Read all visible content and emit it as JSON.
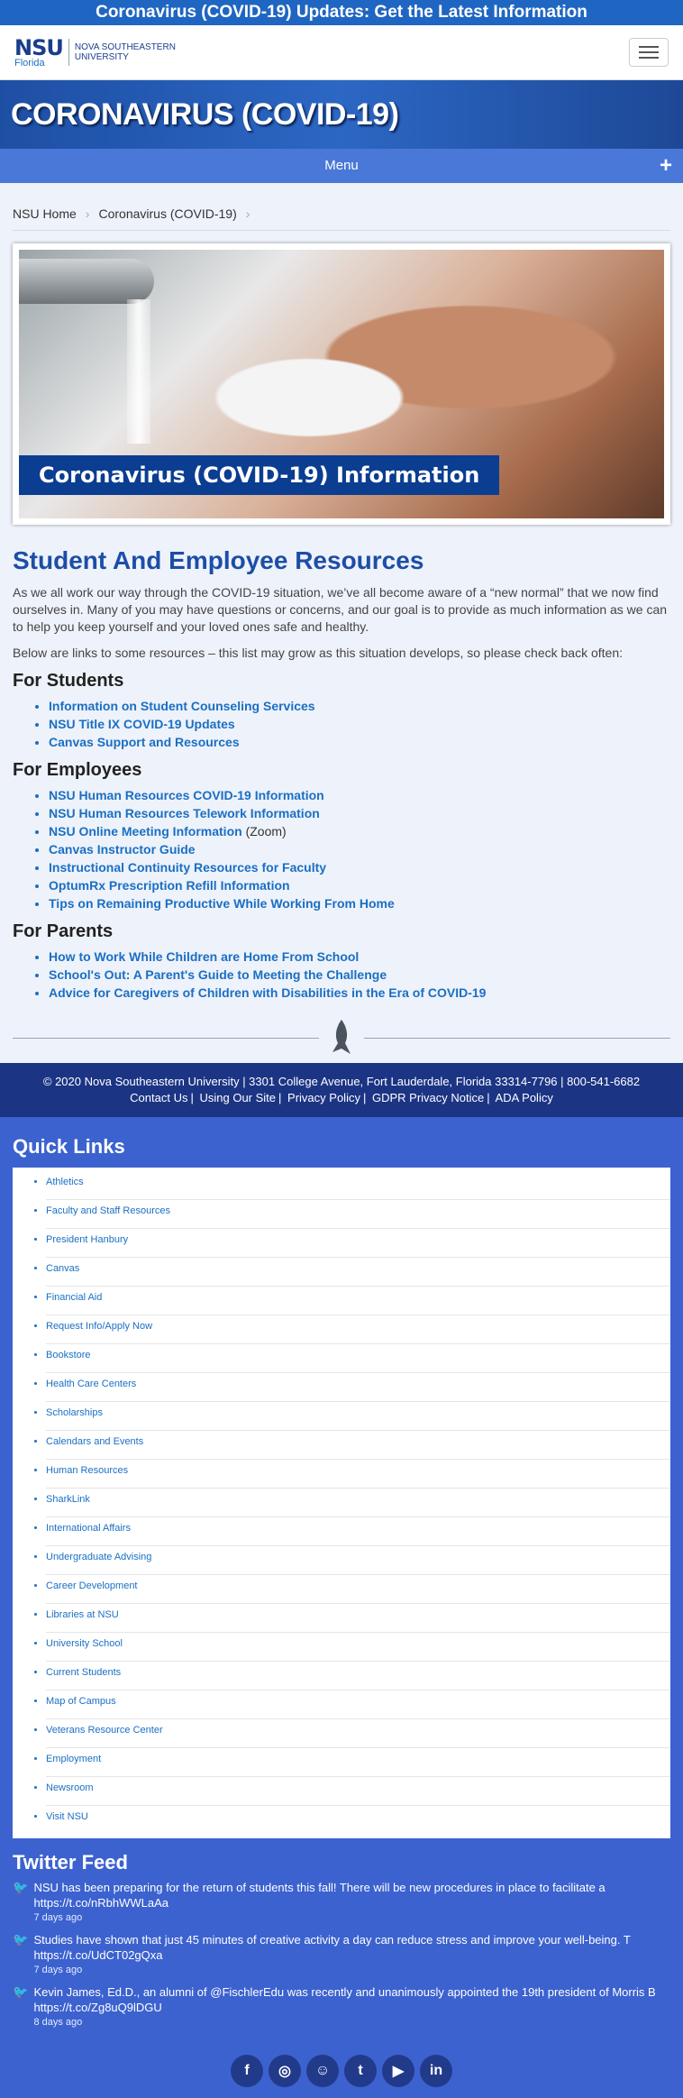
{
  "alert": {
    "text": "Coronavirus (COVID-19) Updates: Get the Latest Information"
  },
  "header": {
    "logo_abbr": "NSU",
    "logo_state": "Florida",
    "logo_name_line1": "NOVA SOUTHEASTERN",
    "logo_name_line2": "UNIVERSITY",
    "menu_icon": "hamburger-icon"
  },
  "hero": {
    "title": "CORONAVIRUS (COVID-19)"
  },
  "menu": {
    "label": "Menu",
    "expand": "+"
  },
  "breadcrumb": {
    "items": [
      "NSU Home",
      "Coronavirus (COVID-19)"
    ]
  },
  "banner": {
    "caption": "Coronavirus (COVID-19) Information"
  },
  "main": {
    "title": "Student And Employee Resources",
    "intro": "As we all work our way through the COVID-19 situation, we’ve all become aware of a “new normal” that we now find ourselves in. Many of you may have questions or concerns, and our goal is to provide as much information as we can to help you keep yourself and your loved ones safe and healthy.",
    "intro2": "Below are links to some resources – this list may grow as this situation develops, so please check back often:",
    "students": {
      "heading": "For Students",
      "links": [
        "Information on Student Counseling Services",
        "NSU Title IX COVID-19 Updates",
        "Canvas Support and Resources"
      ]
    },
    "employees": {
      "heading": "For Employees",
      "links": [
        "NSU Human Resources COVID-19 Information",
        "NSU Human Resources Telework Information",
        "NSU Online Meeting Information",
        "Canvas Instructor Guide",
        "Instructional Continuity Resources for Faculty",
        "OptumRx Prescription Refill Information",
        "Tips on Remaining Productive While Working From Home"
      ],
      "zoom_note": "(Zoom)"
    },
    "parents": {
      "heading": "For Parents",
      "links": [
        "How to Work While Children are Home From School",
        "School's Out: A Parent's Guide to Meeting the Challenge",
        "Advice for Caregivers of Children with Disabilities in the Era of COVID-19"
      ]
    }
  },
  "footer": {
    "address": "© 2020 Nova Southeastern University | 3301 College Avenue, Fort Lauderdale, Florida 33314-7796 | 800-541-6682",
    "links": [
      "Contact Us",
      "Using Our Site",
      "Privacy Policy",
      "GDPR Privacy Notice",
      "ADA Policy"
    ]
  },
  "quick_links": {
    "title": "Quick Links",
    "items": [
      "Athletics",
      "Faculty and Staff Resources",
      "President Hanbury",
      "Canvas",
      "Financial Aid",
      "Request Info/Apply Now",
      "Bookstore",
      "Health Care Centers",
      "Scholarships",
      "Calendars and Events",
      "Human Resources",
      "SharkLink",
      "International Affairs",
      "Undergraduate Advising",
      "Career Development",
      "Libraries at NSU",
      "University School",
      "Current Students",
      "Map of Campus",
      "Veterans Resource Center",
      "Employment",
      "Newsroom",
      "Visit NSU"
    ]
  },
  "twitter": {
    "title": "Twitter Feed",
    "tweets": [
      {
        "text": "NSU has been preparing for the return of students this fall! There will be new procedures in place to facilitate a https://t.co/nRbhWWLaAa",
        "time": "7 days ago"
      },
      {
        "text": "Studies have shown that just 45 minutes of creative activity a day can reduce stress and improve your well-being. T https://t.co/UdCT02gQxa",
        "time": "7 days ago"
      },
      {
        "text": "Kevin James, Ed.D., an alumni of @FischlerEdu was recently and unanimously appointed the 19th president of Morris B https://t.co/Zg8uQ9lDGU",
        "time": "8 days ago"
      }
    ]
  },
  "social": {
    "icons": [
      "facebook-icon",
      "instagram-icon",
      "snapchat-icon",
      "twitter-icon",
      "youtube-icon",
      "linkedin-icon"
    ]
  }
}
